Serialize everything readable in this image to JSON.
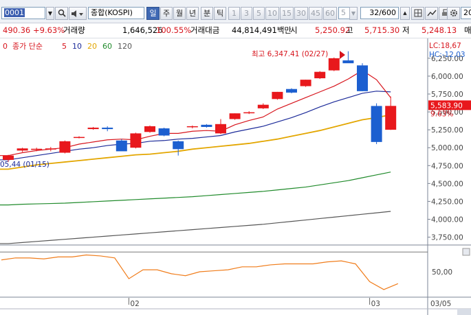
{
  "toolbar": {
    "code": "0001",
    "index_name": "종합(KOSPI)",
    "periods": [
      "일",
      "주",
      "월",
      "년",
      "분",
      "틱"
    ],
    "active_period": "일",
    "intervals": [
      "1",
      "3",
      "5",
      "10",
      "15",
      "30",
      "45",
      "60"
    ],
    "interval_value": "5",
    "count": "32/600",
    "right_label": "20"
  },
  "quote": {
    "change": "490.36",
    "change_rate": "+9.63%",
    "volume_label": "거래량",
    "volume": "1,646,526",
    "volume_ratio": "100.55%",
    "amount_label": "거래대금",
    "amount": "44,814,491백만",
    "open_label": "시",
    "open": "5,250.92",
    "high_label": "고",
    "high": "5,715.30",
    "low_label": "저",
    "low": "5,248.13",
    "extra": "매"
  },
  "chart_data": {
    "type": "candlestick",
    "legend": {
      "name": "종가 단순",
      "periods": [
        "5",
        "10",
        "20",
        "60",
        "120"
      ]
    },
    "ma_colors": {
      "5": "#d7141c",
      "10": "#1b2a99",
      "20": "#e3a600",
      "60": "#1f8a2a",
      "120": "#555555"
    },
    "candles": [
      {
        "o": 4830,
        "h": 4900,
        "l": 4800,
        "c": 4890
      },
      {
        "o": 4960,
        "h": 5000,
        "l": 4940,
        "c": 4990
      },
      {
        "o": 4970,
        "h": 5000,
        "l": 4950,
        "c": 4985
      },
      {
        "o": 4975,
        "h": 5010,
        "l": 4950,
        "c": 4990
      },
      {
        "o": 4930,
        "h": 5100,
        "l": 4920,
        "c": 5090
      },
      {
        "o": 5140,
        "h": 5160,
        "l": 5130,
        "c": 5150
      },
      {
        "o": 5260,
        "h": 5290,
        "l": 5250,
        "c": 5280
      },
      {
        "o": 5280,
        "h": 5300,
        "l": 5230,
        "c": 5260
      },
      {
        "o": 5100,
        "h": 5120,
        "l": 5060,
        "c": 4950
      },
      {
        "o": 5000,
        "h": 5210,
        "l": 4990,
        "c": 5200
      },
      {
        "o": 5220,
        "h": 5310,
        "l": 5210,
        "c": 5300
      },
      {
        "o": 5270,
        "h": 5280,
        "l": 5160,
        "c": 5170
      },
      {
        "o": 5090,
        "h": 5100,
        "l": 4890,
        "c": 4980
      },
      {
        "o": 5290,
        "h": 5310,
        "l": 5270,
        "c": 5300
      },
      {
        "o": 5320,
        "h": 5330,
        "l": 5280,
        "c": 5290
      },
      {
        "o": 5200,
        "h": 5400,
        "l": 5190,
        "c": 5330
      },
      {
        "o": 5400,
        "h": 5480,
        "l": 5390,
        "c": 5480
      },
      {
        "o": 5490,
        "h": 5510,
        "l": 5470,
        "c": 5495
      },
      {
        "o": 5550,
        "h": 5620,
        "l": 5540,
        "c": 5600
      },
      {
        "o": 5680,
        "h": 5780,
        "l": 5670,
        "c": 5780
      },
      {
        "o": 5820,
        "h": 5830,
        "l": 5760,
        "c": 5770
      },
      {
        "o": 5860,
        "h": 5950,
        "l": 5850,
        "c": 5950
      },
      {
        "o": 5970,
        "h": 6070,
        "l": 5960,
        "c": 6060
      },
      {
        "o": 6080,
        "h": 6260,
        "l": 6070,
        "c": 6250
      },
      {
        "o": 6220,
        "h": 6347.41,
        "l": 6200,
        "c": 6180
      },
      {
        "o": 6150,
        "h": 6180,
        "l": 5790,
        "c": 5790
      },
      {
        "o": 5583,
        "h": 5620,
        "l": 5050,
        "c": 5080
      },
      {
        "o": 5250.92,
        "h": 5715.3,
        "l": 5248.13,
        "c": 5583.9
      }
    ],
    "ma5": [
      4890,
      4930,
      4960,
      4980,
      5000,
      5050,
      5080,
      5110,
      5120,
      5110,
      5160,
      5200,
      5200,
      5230,
      5240,
      5230,
      5320,
      5380,
      5430,
      5540,
      5620,
      5700,
      5780,
      5860,
      5960,
      6080,
      5950,
      5700
    ],
    "ma10": [
      4830,
      4860,
      4890,
      4920,
      4950,
      4980,
      5000,
      5030,
      5050,
      5060,
      5090,
      5100,
      5120,
      5130,
      5150,
      5170,
      5220,
      5260,
      5300,
      5360,
      5420,
      5490,
      5570,
      5640,
      5700,
      5760,
      5790,
      5780
    ],
    "ma20": [
      4700,
      4730,
      4760,
      4780,
      4800,
      4820,
      4840,
      4860,
      4880,
      4900,
      4910,
      4930,
      4950,
      4980,
      5000,
      5020,
      5040,
      5060,
      5090,
      5120,
      5160,
      5200,
      5240,
      5290,
      5340,
      5390,
      5420,
      5460
    ],
    "ma60": [
      4200,
      4210,
      4215,
      4220,
      4225,
      4235,
      4245,
      4255,
      4265,
      4275,
      4285,
      4295,
      4305,
      4315,
      4330,
      4345,
      4360,
      4375,
      4390,
      4410,
      4430,
      4450,
      4480,
      4510,
      4540,
      4580,
      4620,
      4660
    ],
    "ma120": [
      3660,
      3675,
      3690,
      3705,
      3720,
      3735,
      3750,
      3765,
      3780,
      3795,
      3810,
      3825,
      3840,
      3855,
      3870,
      3885,
      3900,
      3915,
      3930,
      3950,
      3970,
      3990,
      4010,
      4030,
      4050,
      4070,
      4090,
      4110
    ],
    "oscillator": [
      62,
      64,
      64,
      63,
      65,
      65,
      67,
      66,
      64,
      43,
      52,
      52,
      48,
      46,
      50,
      51,
      52,
      55,
      55,
      57,
      58,
      58,
      58,
      60,
      61,
      58,
      40,
      32,
      38
    ],
    "y_ticks": [
      "3,750.00",
      "4,000.00",
      "4,250.00",
      "4,500.00",
      "4,750.00",
      "5,000.00",
      "5,250.00",
      "5,500.00",
      "5,750.00",
      "6,000.00",
      "6,250.00"
    ],
    "y_range": [
      3650,
      6450
    ],
    "osc_tick": "50,00",
    "osc_mid": "70",
    "x_labels": [
      {
        "label": "02",
        "index": 9
      },
      {
        "label": "03",
        "index": 26
      }
    ],
    "x_end_label": "03/05",
    "annotations": {
      "high": "최고 6,347.41 (02/27)",
      "low": "05,44 (01/15)",
      "lc": "LC:18,67",
      "hc": "HC:-12,03",
      "price": "5,583.90",
      "rate": "9.63%"
    }
  }
}
